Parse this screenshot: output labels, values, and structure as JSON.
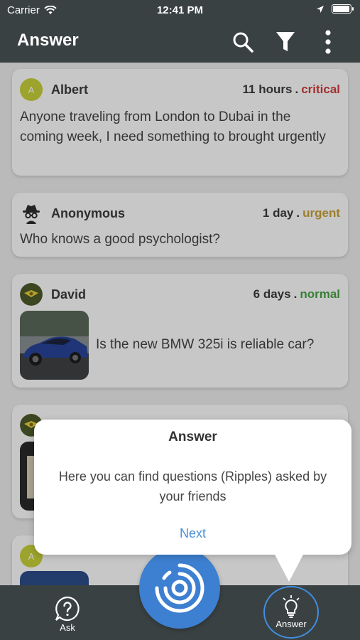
{
  "status_bar": {
    "carrier": "Carrier",
    "time": "12:41 PM",
    "battery_level": 0.95
  },
  "app_bar": {
    "title": "Answer",
    "icons": [
      "search-icon",
      "filter-icon",
      "more-vert-icon"
    ]
  },
  "posts": [
    {
      "avatar_letter": "A",
      "author": "Albert",
      "time": "11 hours",
      "separator": ".",
      "priority": "critical",
      "text": "Anyone traveling from London to Dubai in the coming week, I need something to brought urgently"
    },
    {
      "author": "Anonymous",
      "time": "1 day",
      "separator": ".",
      "priority": "urgent",
      "text": "Who knows a good psychologist?"
    },
    {
      "author": "David",
      "time": "6 days",
      "separator": ".",
      "priority": "normal",
      "text": "Is the new BMW 325i is reliable car?"
    },
    {
      "author": "",
      "time": "",
      "priority": ""
    },
    {
      "avatar_letter": "A",
      "author": "",
      "time": "",
      "priority": ""
    }
  ],
  "tooltip": {
    "title": "Answer",
    "body": "Here you can find questions (Ripples) asked by your friends",
    "next_label": "Next"
  },
  "bottom_nav": {
    "ask_label": "Ask",
    "answer_label": "Answer",
    "accent_color": "#3d7fd0"
  },
  "colors": {
    "bar": "#3a4142",
    "critical": "#d23b3b",
    "urgent": "#c8a23a",
    "normal": "#48a347"
  }
}
